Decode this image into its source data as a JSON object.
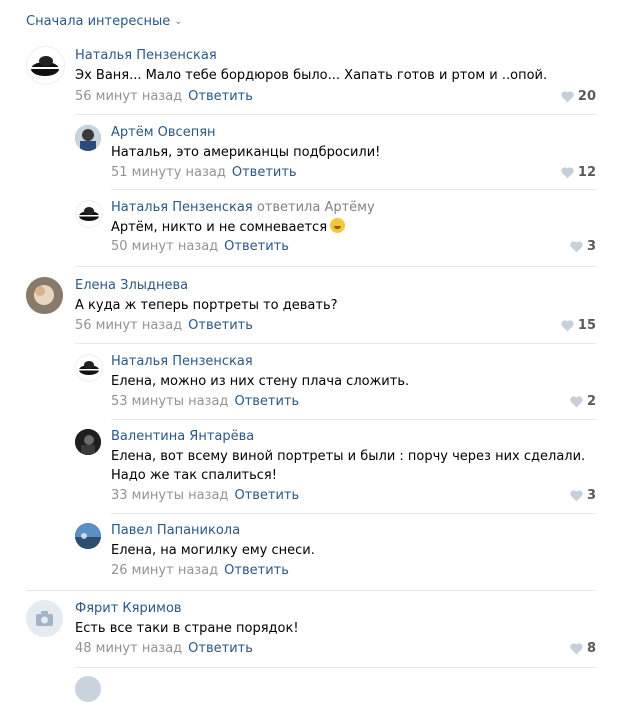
{
  "sort_label": "Сначала интересные",
  "comments": [
    {
      "author": "Наталья Пензенская",
      "text": "Эх Ваня... Мало тебе бордюров было... Хапать готов и ртом и ..опой.",
      "time": "56 минут назад",
      "reply_label": "Ответить",
      "likes": "20"
    },
    {
      "author": "Артём Овсепян",
      "text": "Наталья, это американцы подбросили!",
      "time": "51 минуту назад",
      "reply_label": "Ответить",
      "likes": "12"
    },
    {
      "author": "Наталья Пензенская",
      "replied": "ответила Артёму",
      "text": "Артём, никто и не сомневается",
      "time": "50 минут назад",
      "reply_label": "Ответить",
      "likes": "3"
    },
    {
      "author": "Елена Злыднева",
      "text": "А куда ж теперь портреты то девать?",
      "time": "56 минут назад",
      "reply_label": "Ответить",
      "likes": "15"
    },
    {
      "author": "Наталья Пензенская",
      "text": "Елена, можно из них стену плача сложить.",
      "time": "53 минуты назад",
      "reply_label": "Ответить",
      "likes": "2"
    },
    {
      "author": "Валентина Янтарёва",
      "text": "Елена, вот всему виной портреты и были : порчу через них сделали.",
      "text2": "Надо же так спалиться!",
      "time": "33 минуты назад",
      "reply_label": "Ответить",
      "likes": "3"
    },
    {
      "author": "Павел Папаникола",
      "text": "Елена, на могилку ему снеси.",
      "time": "26 минут назад",
      "reply_label": "Ответить",
      "likes": ""
    },
    {
      "author": "Фярит Кяримов",
      "text": "Есть все таки в стране порядок!",
      "time": "48 минут назад",
      "reply_label": "Ответить",
      "likes": "8"
    }
  ]
}
